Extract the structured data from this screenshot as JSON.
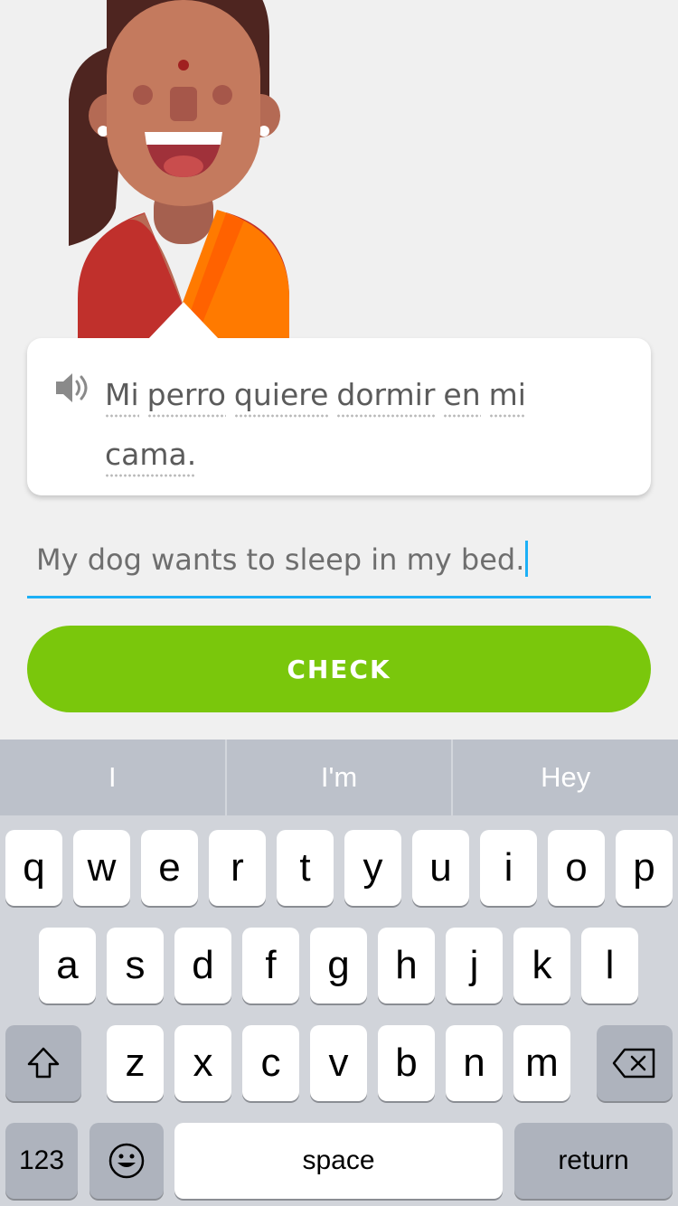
{
  "exercise": {
    "prompt_words": [
      "Mi",
      "perro",
      "quiere",
      "dormir",
      "en",
      "mi",
      "cama."
    ],
    "answer_value": "My dog wants to sleep in my bed.",
    "check_label": "CHECK",
    "speaker_icon": "speaker-icon"
  },
  "keyboard": {
    "suggestions": [
      "I",
      "I'm",
      "Hey"
    ],
    "row1": [
      "q",
      "w",
      "e",
      "r",
      "t",
      "y",
      "u",
      "i",
      "o",
      "p"
    ],
    "row2": [
      "a",
      "s",
      "d",
      "f",
      "g",
      "h",
      "j",
      "k",
      "l"
    ],
    "row3": [
      "z",
      "x",
      "c",
      "v",
      "b",
      "n",
      "m"
    ],
    "numbers_label": "123",
    "space_label": "space",
    "return_label": "return",
    "shift_icon": "shift-icon",
    "backspace_icon": "backspace-icon",
    "emoji_icon": "emoji-icon"
  },
  "colors": {
    "accent_blue": "#1cb0f6",
    "check_green": "#7ac70c",
    "background": "#f0f0f0"
  }
}
